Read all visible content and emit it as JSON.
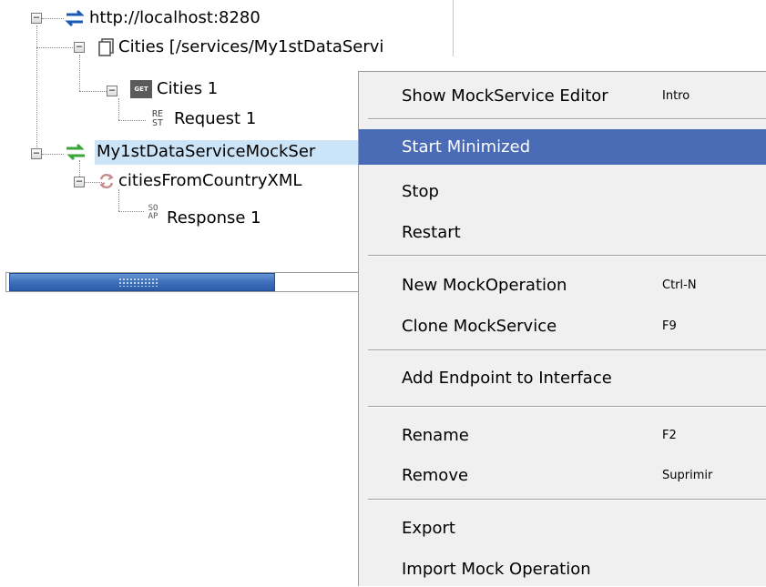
{
  "tree": {
    "project_url": "http://localhost:8280",
    "resource": "Cities [/services/My1stDataServi",
    "method_badge": "GET",
    "method": "Cities 1",
    "request_badge_top": "RE",
    "request_badge_bottom": "ST",
    "request": "Request 1",
    "mockservice": "My1stDataServiceMockSer",
    "mock_operation": "citiesFromCountryXML",
    "response_badge_top": "SO",
    "response_badge_bottom": "AP",
    "response": "Response 1"
  },
  "context_menu": {
    "items": [
      {
        "label": "Show MockService Editor",
        "shortcut": "Intro"
      },
      {
        "label": "Start Minimized",
        "shortcut": ""
      },
      {
        "label": "Stop",
        "shortcut": ""
      },
      {
        "label": "Restart",
        "shortcut": ""
      },
      {
        "label": "New MockOperation",
        "shortcut": "Ctrl-N"
      },
      {
        "label": "Clone MockService",
        "shortcut": "F9"
      },
      {
        "label": "Add Endpoint to Interface",
        "shortcut": ""
      },
      {
        "label": "Rename",
        "shortcut": "F2"
      },
      {
        "label": "Remove",
        "shortcut": "Suprimir"
      },
      {
        "label": "Export",
        "shortcut": ""
      },
      {
        "label": "Import Mock Operation",
        "shortcut": ""
      }
    ],
    "highlighted_item": "Start Minimized"
  },
  "colors": {
    "menu_highlight": "#4a6bb5",
    "selection": "#cce4f7",
    "scroll_thumb": "#3d6fba"
  }
}
